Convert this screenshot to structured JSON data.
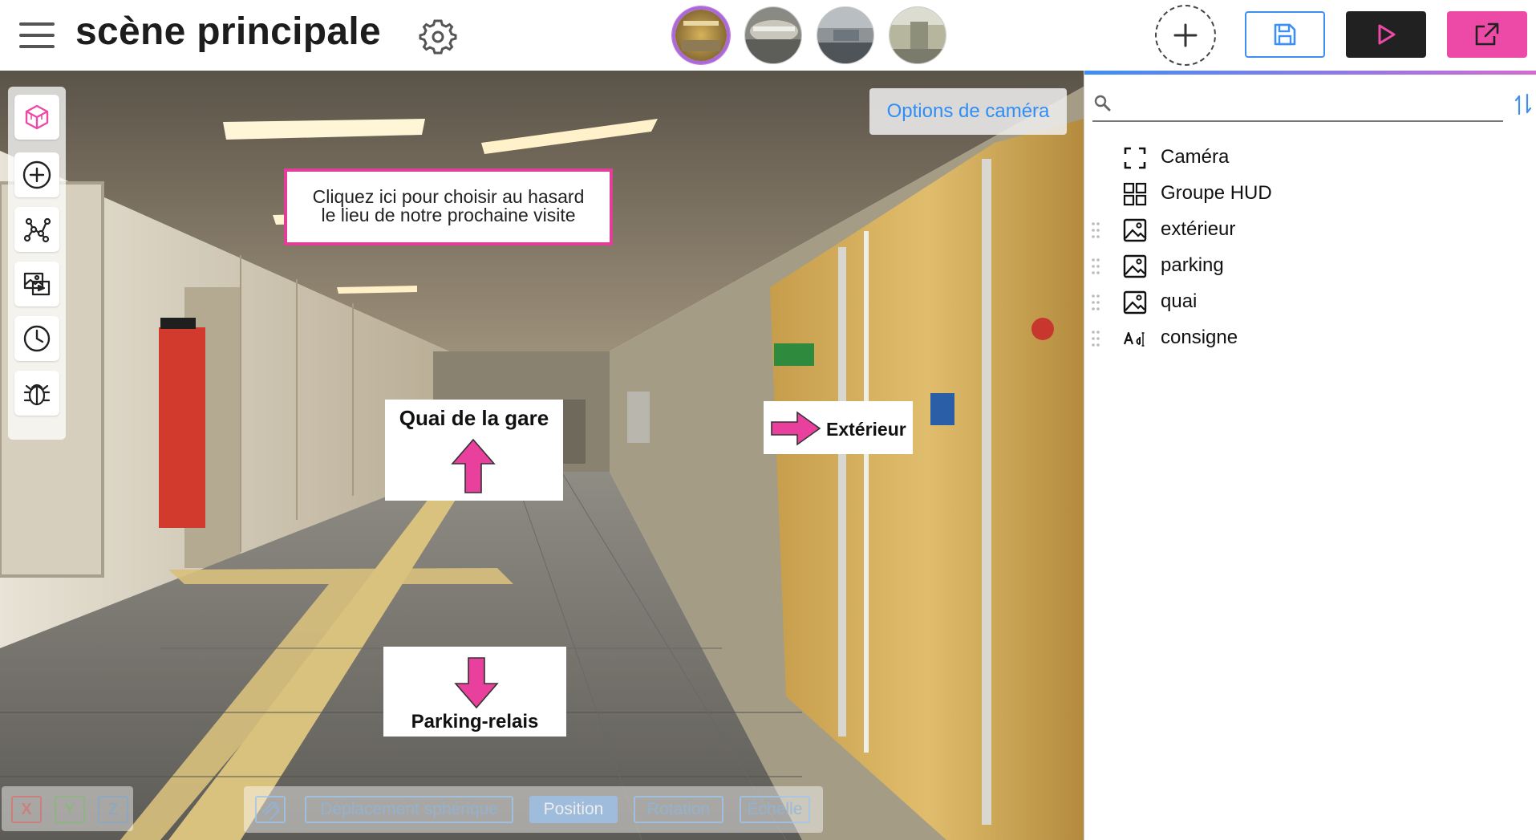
{
  "header": {
    "title": "scène principale",
    "scenes": [
      {
        "name": "scene-thumb-1",
        "active": true,
        "has_flag": true
      },
      {
        "name": "scene-thumb-2",
        "active": false
      },
      {
        "name": "scene-thumb-3",
        "active": false
      },
      {
        "name": "scene-thumb-4",
        "active": false
      }
    ]
  },
  "viewport": {
    "camera_options_label": "Options de caméra",
    "hud": {
      "note_line1": "Cliquez ici pour choisir au hasard",
      "note_line2": "le lieu de notre prochaine visite",
      "quai_label": "Quai de la gare",
      "exterieur_label": "Extérieur",
      "parking_label": "Parking-relais"
    },
    "axes": {
      "x": "X",
      "y": "Y",
      "z": "Z"
    },
    "transform": {
      "spherical": "Déplacement sphérique",
      "position": "Position",
      "rotation": "Rotation",
      "scale": "Échelle",
      "selected": "Position"
    }
  },
  "panel": {
    "search_placeholder": "",
    "items": [
      {
        "label": "Caméra",
        "icon": "camera-frame-icon"
      },
      {
        "label": "Groupe HUD",
        "icon": "grid-icon"
      },
      {
        "label": "extérieur",
        "icon": "image-icon"
      },
      {
        "label": "parking",
        "icon": "image-icon"
      },
      {
        "label": "quai",
        "icon": "image-icon"
      },
      {
        "label": "consigne",
        "icon": "text-icon"
      }
    ]
  },
  "colors": {
    "accent_blue": "#3d8ff4",
    "accent_pink": "#ec4aa6",
    "dark": "#212121"
  }
}
